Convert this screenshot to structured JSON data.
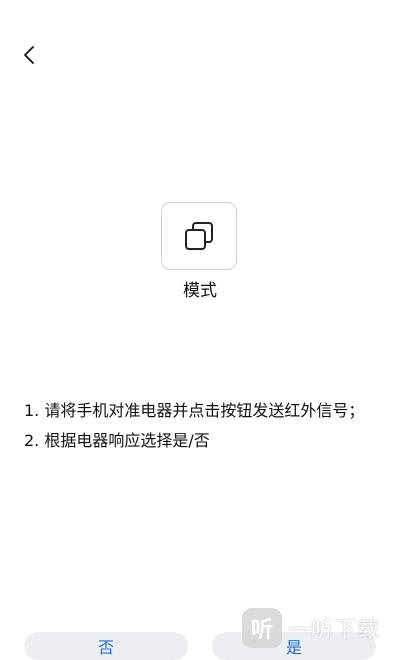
{
  "header": {
    "back_icon": "chevron-left-icon"
  },
  "mode": {
    "icon": "copy-icon",
    "label": "模式"
  },
  "instructions": {
    "line1": "1. 请将手机对准电器并点击按钮发送红外信号；",
    "line2": "2. 根据电器响应选择是/否"
  },
  "buttons": {
    "no_label": "否",
    "yes_label": "是",
    "accent": "#1f6fd6"
  },
  "watermark": {
    "badge": "听",
    "text": "一听下载"
  }
}
